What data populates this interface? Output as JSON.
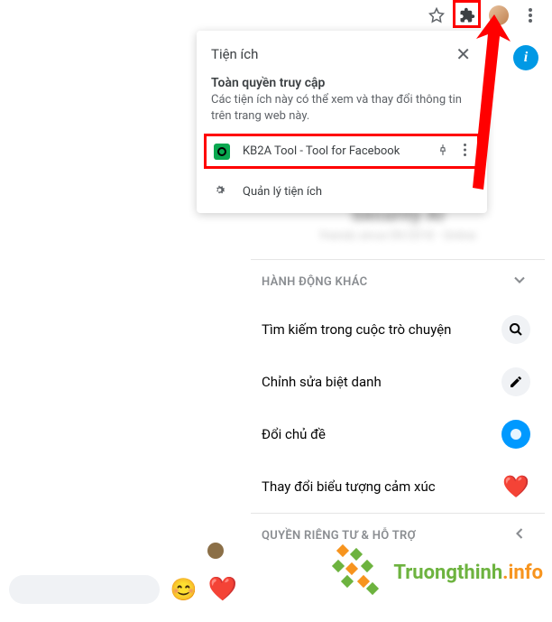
{
  "toolbar": {
    "star": "star-icon",
    "extensions": "puzzle-icon",
    "menu": "menu-icon"
  },
  "popup": {
    "title": "Tiện ích",
    "subtitle": "Toàn quyền truy cập",
    "desc": "Các tiện ích này có thể xem và thay đổi thông tin trên trang web này.",
    "items": [
      {
        "name": "KB2A Tool - Tool for Facebook"
      }
    ],
    "manage": "Quản lý tiện ích"
  },
  "info_badge": "i",
  "chat": {
    "name": "Security AI",
    "sub": "friends since 09/2018 · Online",
    "section_other": "HÀNH ĐỘNG KHÁC",
    "section_privacy": "QUYỀN RIÊNG TƯ & HỖ TRỢ",
    "actions": {
      "search": "Tìm kiếm trong cuộc trò chuyện",
      "nickname": "Chỉnh sửa biệt danh",
      "theme": "Đổi chủ đề",
      "emoji": "Thay đổi biểu tượng cảm xúc"
    },
    "heart_emoji": "❤️",
    "smile_emoji": "😊"
  },
  "watermark": {
    "text1": "Truongthinh",
    "text2": ".info"
  }
}
